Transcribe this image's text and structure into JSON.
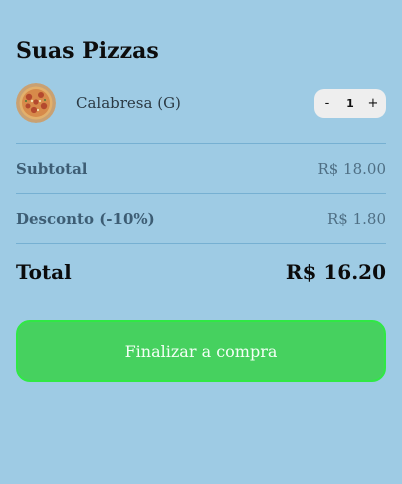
{
  "cart": {
    "title": "Suas Pizzas",
    "items": [
      {
        "name": "Calabresa (G)",
        "quantity": "1",
        "thumbnail_icon": "pizza-thumbnail",
        "decrement_label": "-",
        "increment_label": "+"
      }
    ]
  },
  "summary": {
    "subtotal_label": "Subtotal",
    "subtotal_value": "R$ 18.00",
    "discount_label": "Desconto (-10%)",
    "discount_value": "R$ 1.80",
    "total_label": "Total",
    "total_value": "R$ 16.20"
  },
  "checkout": {
    "button_label": "Finalizar a compra"
  },
  "colors": {
    "background": "#9ecbe4",
    "checkout_button": "#46d15f",
    "stepper_bg": "#eeeeee"
  }
}
